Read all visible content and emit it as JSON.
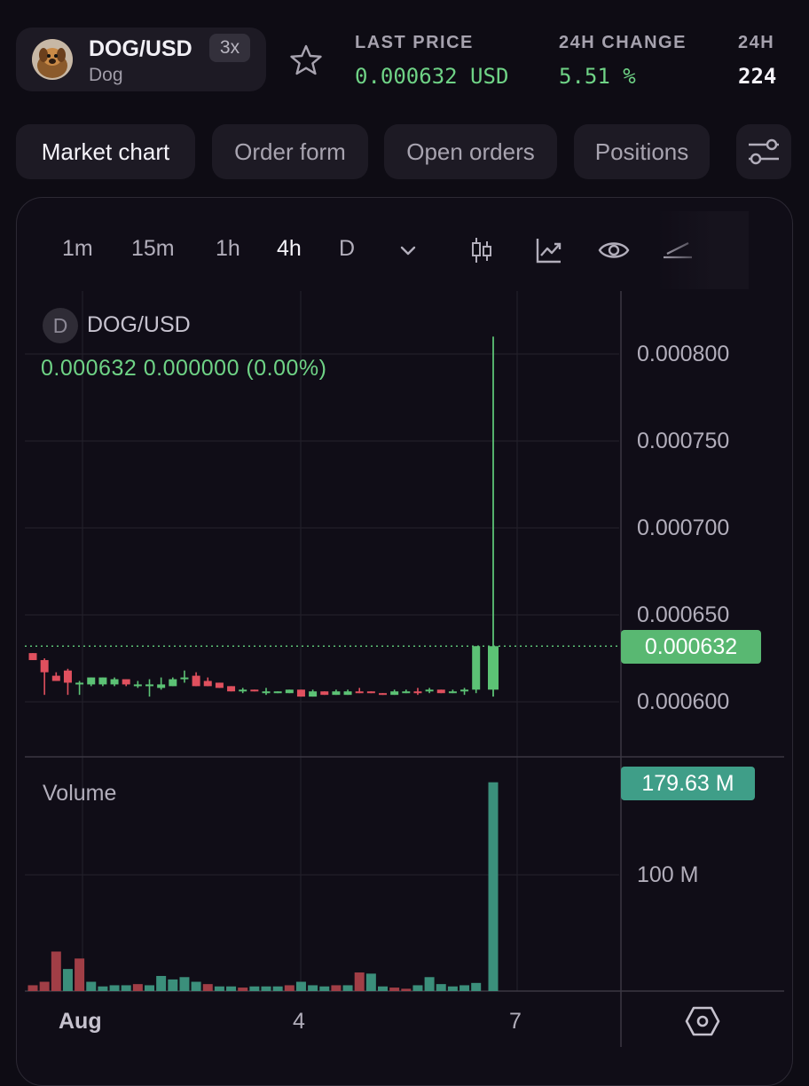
{
  "header": {
    "pair": "DOG/USD",
    "leverage": "3x",
    "name": "Dog",
    "stats": [
      {
        "label": "LAST PRICE",
        "value": "0.000632 USD"
      },
      {
        "label": "24H CHANGE",
        "value": "5.51 %"
      },
      {
        "label": "24H",
        "value": "224"
      }
    ]
  },
  "tabs": [
    "Market chart",
    "Order form",
    "Open orders",
    "Positions"
  ],
  "toolbar": {
    "intervals": [
      "1m",
      "15m",
      "1h",
      "4h",
      "D"
    ],
    "active_interval": "4h",
    "icons": [
      "chevron-down-icon",
      "candlestick-icon",
      "indicators-icon",
      "eye-icon",
      "drawing-icon"
    ]
  },
  "legend": {
    "badge": "D",
    "symbol": "DOG/USD",
    "values": "0.000632  0.000000 (0.00%)"
  },
  "price_axis": [
    "0.000800",
    "0.000750",
    "0.000700",
    "0.000650",
    "0.000600"
  ],
  "current_price": "0.000632",
  "volume": {
    "label": "Volume",
    "last": "179.63 M",
    "axis": "100 M"
  },
  "dates": [
    "Aug",
    "4",
    "7"
  ],
  "colors": {
    "up": "#5cc275",
    "down": "#e0505e",
    "vol_up": "#3b8f7b",
    "vol_down": "#a13e46"
  },
  "chart_data": {
    "type": "candlestick",
    "ylim": [
      0.000585,
      0.000825
    ],
    "candles": [
      {
        "o": 0.000628,
        "h": 0.000628,
        "c": 0.000624,
        "l": 0.000624
      },
      {
        "o": 0.000624,
        "h": 0.000625,
        "c": 0.000617,
        "l": 0.000604
      },
      {
        "o": 0.000615,
        "h": 0.000617,
        "c": 0.000612,
        "l": 0.000612
      },
      {
        "o": 0.000618,
        "h": 0.000619,
        "c": 0.000611,
        "l": 0.000604
      },
      {
        "o": 0.00061,
        "h": 0.000612,
        "c": 0.000611,
        "l": 0.000604
      },
      {
        "o": 0.00061,
        "h": 0.000614,
        "c": 0.000614,
        "l": 0.000609
      },
      {
        "o": 0.00061,
        "h": 0.000614,
        "c": 0.000614,
        "l": 0.000609
      },
      {
        "o": 0.00061,
        "h": 0.000614,
        "c": 0.000613,
        "l": 0.000609
      },
      {
        "o": 0.000613,
        "h": 0.000613,
        "c": 0.00061,
        "l": 0.000609
      },
      {
        "o": 0.00061,
        "h": 0.000612,
        "c": 0.00061,
        "l": 0.000608
      },
      {
        "o": 0.000609,
        "h": 0.000613,
        "c": 0.00061,
        "l": 0.000603
      },
      {
        "o": 0.000608,
        "h": 0.000614,
        "c": 0.00061,
        "l": 0.000607
      },
      {
        "o": 0.000609,
        "h": 0.000614,
        "c": 0.000613,
        "l": 0.000609
      },
      {
        "o": 0.000613,
        "h": 0.000618,
        "c": 0.000614,
        "l": 0.000611
      },
      {
        "o": 0.000615,
        "h": 0.000617,
        "c": 0.000609,
        "l": 0.000609
      },
      {
        "o": 0.000612,
        "h": 0.000614,
        "c": 0.000609,
        "l": 0.000609
      },
      {
        "o": 0.000611,
        "h": 0.000611,
        "c": 0.000608,
        "l": 0.000608
      },
      {
        "o": 0.000609,
        "h": 0.000609,
        "c": 0.000606,
        "l": 0.000606
      },
      {
        "o": 0.000606,
        "h": 0.000608,
        "c": 0.000607,
        "l": 0.000605
      },
      {
        "o": 0.000607,
        "h": 0.000607,
        "c": 0.000606,
        "l": 0.000606
      },
      {
        "o": 0.000606,
        "h": 0.000608,
        "c": 0.000606,
        "l": 0.000604
      },
      {
        "o": 0.000606,
        "h": 0.000606,
        "c": 0.000606,
        "l": 0.000605
      },
      {
        "o": 0.000605,
        "h": 0.000607,
        "c": 0.000607,
        "l": 0.000605
      },
      {
        "o": 0.000607,
        "h": 0.000607,
        "c": 0.000603,
        "l": 0.000603
      },
      {
        "o": 0.000603,
        "h": 0.000607,
        "c": 0.000606,
        "l": 0.000603
      },
      {
        "o": 0.000606,
        "h": 0.000606,
        "c": 0.000604,
        "l": 0.000604
      },
      {
        "o": 0.000604,
        "h": 0.000607,
        "c": 0.000606,
        "l": 0.000604
      },
      {
        "o": 0.000604,
        "h": 0.000607,
        "c": 0.000606,
        "l": 0.000604
      },
      {
        "o": 0.000606,
        "h": 0.000608,
        "c": 0.000605,
        "l": 0.000605
      },
      {
        "o": 0.000606,
        "h": 0.000606,
        "c": 0.000605,
        "l": 0.000605
      },
      {
        "o": 0.000605,
        "h": 0.000605,
        "c": 0.000604,
        "l": 0.000604
      },
      {
        "o": 0.000604,
        "h": 0.000607,
        "c": 0.000606,
        "l": 0.000604
      },
      {
        "o": 0.000605,
        "h": 0.000607,
        "c": 0.000606,
        "l": 0.000605
      },
      {
        "o": 0.000606,
        "h": 0.000608,
        "c": 0.000605,
        "l": 0.000604
      },
      {
        "o": 0.000606,
        "h": 0.000608,
        "c": 0.000607,
        "l": 0.000605
      },
      {
        "o": 0.000607,
        "h": 0.000607,
        "c": 0.000605,
        "l": 0.000605
      },
      {
        "o": 0.000605,
        "h": 0.000607,
        "c": 0.000606,
        "l": 0.000605
      },
      {
        "o": 0.000606,
        "h": 0.000608,
        "c": 0.000607,
        "l": 0.000604
      },
      {
        "o": 0.000607,
        "h": 0.000632,
        "c": 0.000632,
        "l": 0.000605
      }
    ],
    "big_candle": {
      "o": 0.000607,
      "h": 0.00081,
      "c": 0.000632,
      "l": 0.000603
    },
    "volumes_M": [
      5,
      8,
      34,
      19,
      28,
      8,
      4,
      5,
      5,
      6,
      5,
      13,
      10,
      12,
      8,
      6,
      4,
      4,
      3,
      4,
      4,
      4,
      5,
      8,
      5,
      4,
      5,
      5,
      16,
      15,
      4,
      3,
      2,
      5,
      12,
      6,
      4,
      5,
      7,
      179.63
    ],
    "volume_dirs": [
      "d",
      "d",
      "d",
      "u",
      "d",
      "u",
      "u",
      "u",
      "u",
      "d",
      "u",
      "u",
      "u",
      "u",
      "u",
      "d",
      "u",
      "u",
      "d",
      "u",
      "u",
      "u",
      "d",
      "u",
      "u",
      "u",
      "d",
      "u",
      "d",
      "u",
      "u",
      "d",
      "d",
      "u",
      "u",
      "u",
      "u",
      "u",
      "u",
      "u"
    ]
  }
}
